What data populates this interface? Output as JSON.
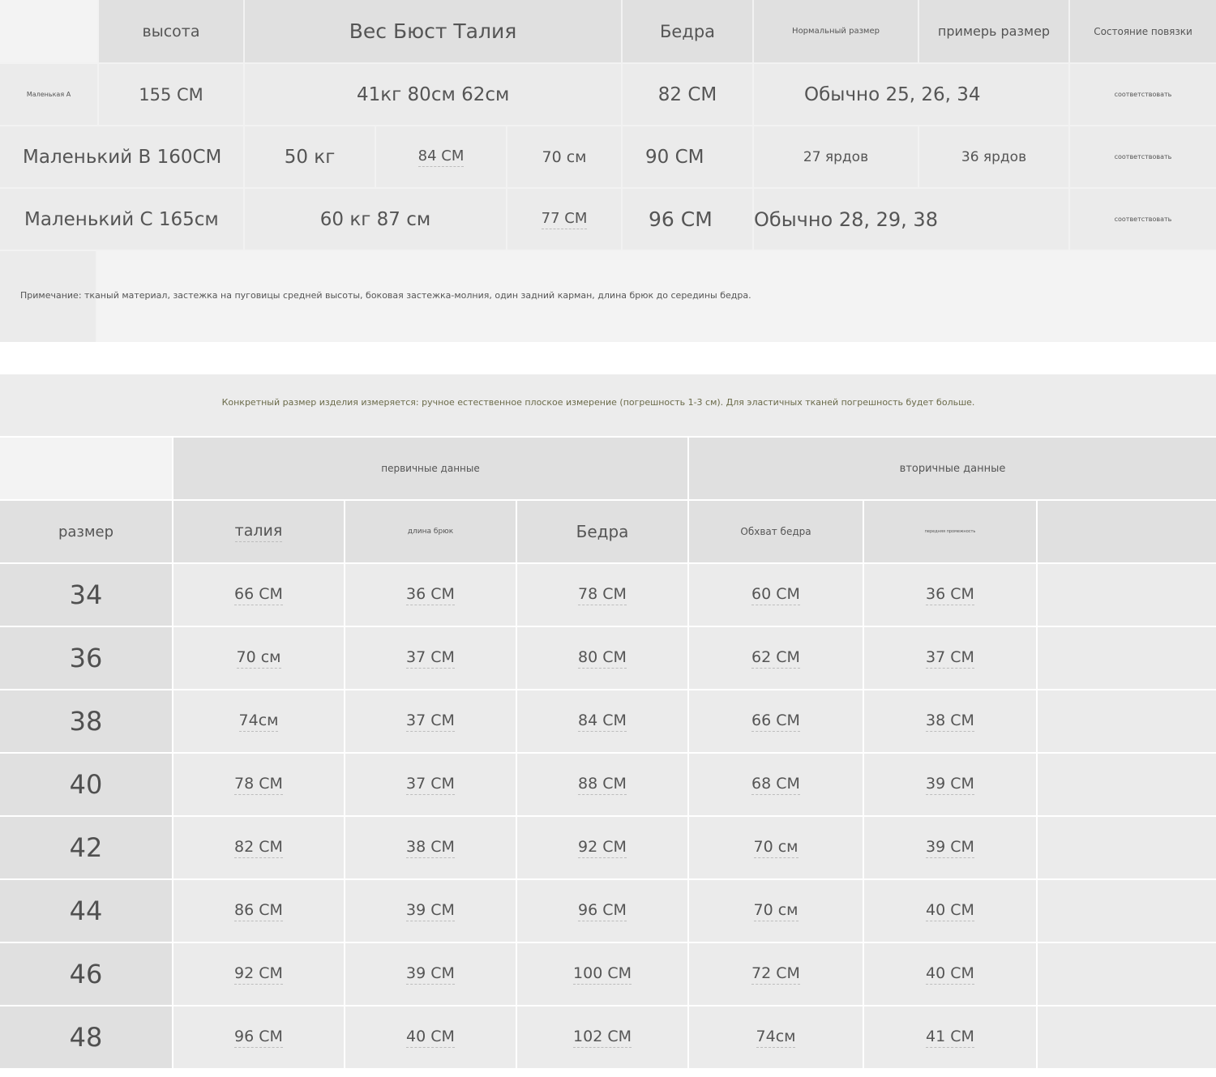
{
  "top_table": {
    "headers": [
      "высота",
      "Вес Бюст Талия",
      "Бедра",
      "Нормальный размер",
      "примерь размер",
      "Состояние повязки"
    ],
    "rows": [
      {
        "label": "Маленькая А",
        "height": "155 СМ",
        "weight_bust_waist": "41кг 80см 62см",
        "hips": "82 СМ",
        "normal_try": "Обычно 25, 26, 34",
        "bandage": "соответствовать"
      },
      {
        "label": "Маленький В 160СМ",
        "weight": "50 кг",
        "bust": "84 СМ",
        "waist": "70 см",
        "hips": "90 СМ",
        "normal": "27 ярдов",
        "try": "36 ярдов",
        "bandage": "соответствовать"
      },
      {
        "label": "Маленький С 165см",
        "weight_bust": "60 кг 87 см",
        "waist": "77 СМ",
        "hips": "96 СМ",
        "normal_try": "Обычно 28, 29, 38",
        "bandage": "соответствовать"
      }
    ],
    "note": "Примечание: тканый материал, застежка на пуговицы средней высоты, боковая застежка-молния, один задний карман, длина брюк до середины бедра."
  },
  "measure_note": "Конкретный размер изделия измеряется: ручное естественное плоское измерение (погрешность 1-3 см). Для эластичных тканей погрешность будет больше.",
  "bottom_table": {
    "group_primary": "первичные данные",
    "group_secondary": "вторичные данные",
    "headers": [
      "размер",
      "талия",
      "длина брюк",
      "Бедра",
      "Обхват бедра",
      "передняя промежность"
    ],
    "rows": [
      [
        "34",
        "66 СМ",
        "36 СМ",
        "78 СМ",
        "60 СМ",
        "36 СМ"
      ],
      [
        "36",
        "70 см",
        "37 СМ",
        "80 СМ",
        "62 СМ",
        "37 СМ"
      ],
      [
        "38",
        "74см",
        "37 СМ",
        "84 СМ",
        "66 СМ",
        "38 СМ"
      ],
      [
        "40",
        "78 СМ",
        "37 СМ",
        "88 СМ",
        "68 СМ",
        "39 СМ"
      ],
      [
        "42",
        "82 СМ",
        "38 СМ",
        "92 СМ",
        "70 см",
        "39 СМ"
      ],
      [
        "44",
        "86 СМ",
        "39 СМ",
        "96 СМ",
        "70 см",
        "40 СМ"
      ],
      [
        "46",
        "92 СМ",
        "39 СМ",
        "100 СМ",
        "72 СМ",
        "40 СМ"
      ],
      [
        "48",
        "96 СМ",
        "40 СМ",
        "102 СМ",
        "74см",
        "41 СМ"
      ]
    ]
  },
  "colors": {
    "header_gray": "#e0e0e0",
    "cell_gray": "#ebebeb",
    "light_gray": "#f3f3f3",
    "text": "#555555",
    "note_text": "#6b6b4a"
  }
}
